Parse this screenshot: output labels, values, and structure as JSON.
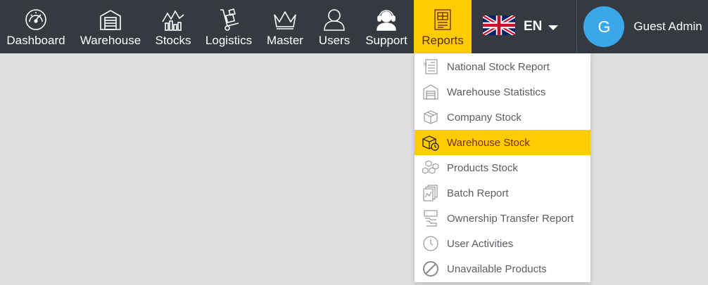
{
  "nav": {
    "items": [
      {
        "label": "Dashboard",
        "icon": "gauge-icon"
      },
      {
        "label": "Warehouse",
        "icon": "warehouse-icon"
      },
      {
        "label": "Stocks",
        "icon": "stocks-chart-icon"
      },
      {
        "label": "Logistics",
        "icon": "hand-truck-icon"
      },
      {
        "label": "Master",
        "icon": "crown-icon"
      },
      {
        "label": "Users",
        "icon": "user-icon"
      },
      {
        "label": "Support",
        "icon": "headset-icon"
      },
      {
        "label": "Reports",
        "icon": "report-sheet-icon",
        "active": true
      }
    ],
    "active_color": "#ffcc00",
    "bar_color": "#343a40"
  },
  "language": {
    "code": "EN",
    "flag": "uk-flag-icon"
  },
  "user": {
    "initial": "G",
    "name": "Guest Admin",
    "avatar_color": "#3aa7e8"
  },
  "reports_menu": {
    "items": [
      {
        "label": "National Stock Report",
        "icon": "national-report-icon"
      },
      {
        "label": "Warehouse Statistics",
        "icon": "warehouse-stats-icon"
      },
      {
        "label": "Company Stock",
        "icon": "box-icon"
      },
      {
        "label": "Warehouse Stock",
        "icon": "warehouse-stock-icon",
        "active": true
      },
      {
        "label": "Products Stock",
        "icon": "boxes-icon"
      },
      {
        "label": "Batch Report",
        "icon": "documents-icon"
      },
      {
        "label": "Ownership Transfer Report",
        "icon": "transfer-hand-icon"
      },
      {
        "label": "User Activities",
        "icon": "clock-icon"
      },
      {
        "label": "Unavailable Products",
        "icon": "prohibited-icon"
      }
    ]
  }
}
